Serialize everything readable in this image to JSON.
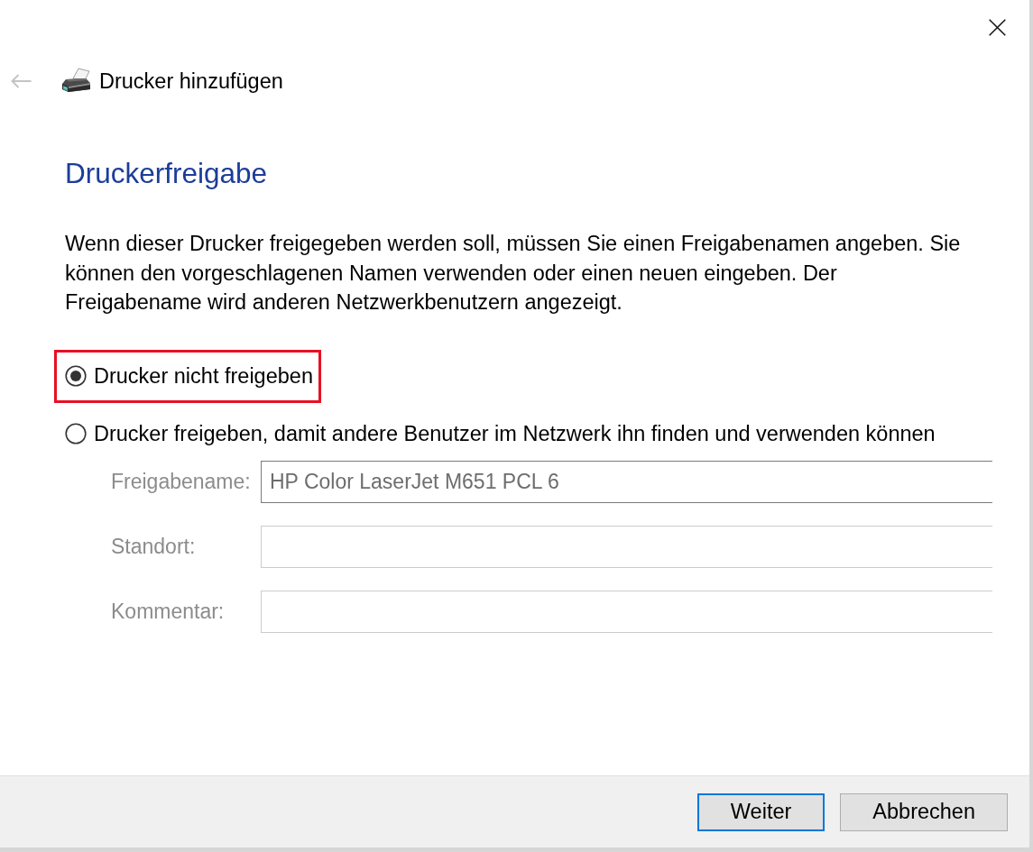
{
  "header": {
    "back_button": {
      "disabled": true
    },
    "title": "Drucker hinzufügen"
  },
  "page": {
    "heading": "Druckerfreigabe",
    "description": "Wenn dieser Drucker freigegeben werden soll, müssen Sie einen Freigabenamen angeben. Sie können den vorgeschlagenen Namen verwenden oder einen neuen eingeben. Der Freigabename wird anderen Netzwerkbenutzern angezeigt."
  },
  "share_options": [
    {
      "label": "Drucker nicht freigeben",
      "selected": true,
      "highlighted": true
    },
    {
      "label": "Drucker freigeben, damit andere Benutzer im Netzwerk ihn finden und verwenden können",
      "selected": false,
      "highlighted": false
    }
  ],
  "share_fields": [
    {
      "label": "Freigabename:",
      "value": "HP Color LaserJet M651 PCL 6",
      "disabled": true
    },
    {
      "label": "Standort:",
      "disabled": true
    },
    {
      "label": "Kommentar:",
      "disabled": true
    }
  ],
  "buttons": [
    {
      "label": "Weiter",
      "default": true
    },
    {
      "label": "Abbrechen",
      "default": false
    }
  ]
}
